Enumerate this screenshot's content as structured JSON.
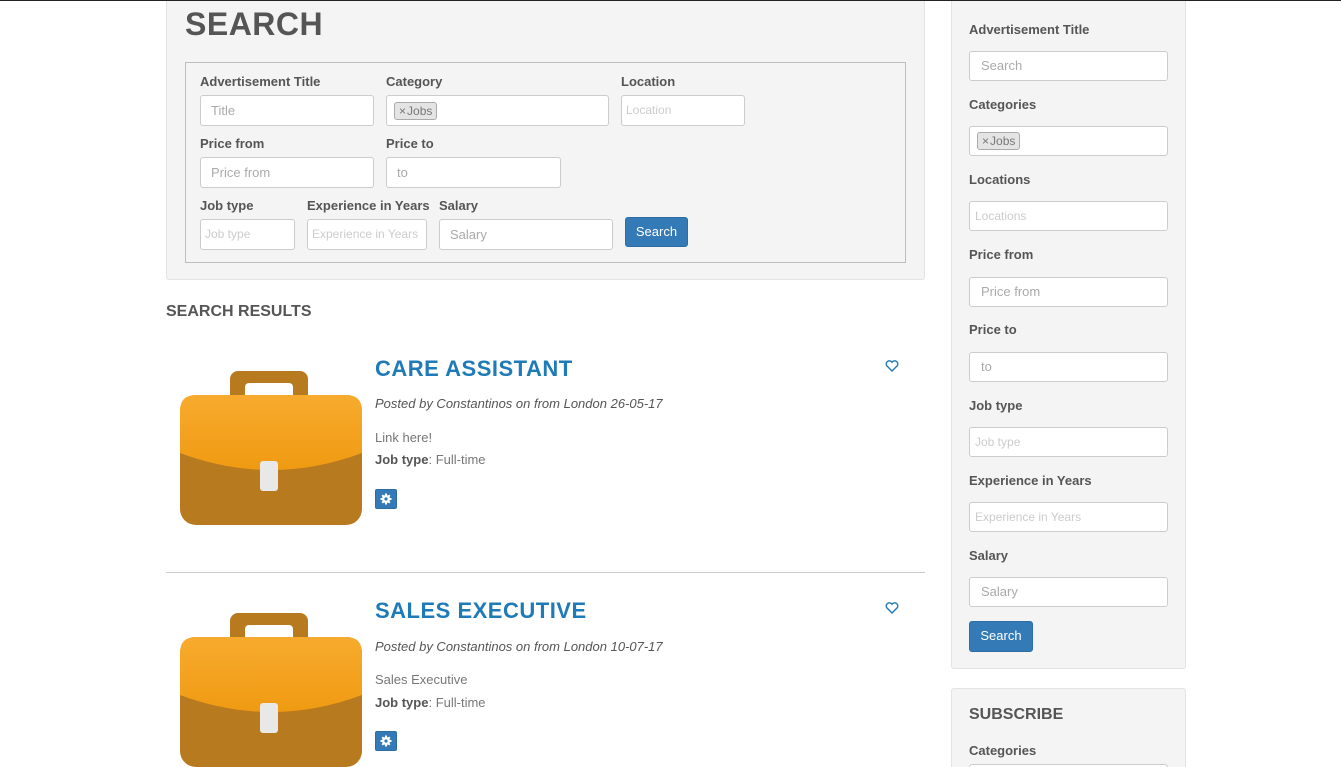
{
  "search": {
    "heading": "SEARCH",
    "fields": {
      "title": {
        "label": "Advertisement Title",
        "placeholder": "Title"
      },
      "category": {
        "label": "Category",
        "tag": "Jobs"
      },
      "location": {
        "label": "Location",
        "placeholder": "Location"
      },
      "price_from": {
        "label": "Price from",
        "placeholder": "Price from"
      },
      "price_to": {
        "label": "Price to",
        "placeholder": "to"
      },
      "job_type": {
        "label": "Job type",
        "placeholder": "Job type"
      },
      "experience": {
        "label": "Experience in Years",
        "placeholder": "Experience in Years"
      },
      "salary": {
        "label": "Salary",
        "placeholder": "Salary"
      }
    },
    "button": "Search"
  },
  "results": {
    "heading": "SEARCH RESULTS",
    "items": [
      {
        "title": "CARE ASSISTANT",
        "meta": "Posted by Constantinos on from London 26-05-17",
        "description": "Link here!",
        "job_type_label": "Job type",
        "job_type_value": ": Full-time",
        "icon": "briefcase-icon"
      },
      {
        "title": "SALES EXECUTIVE",
        "meta": "Posted by Constantinos on from London 10-07-17",
        "description": "Sales Executive",
        "job_type_label": "Job type",
        "job_type_value": ": Full-time",
        "icon": "briefcase-icon"
      }
    ]
  },
  "sidebar": {
    "fields": [
      {
        "label": "Advertisement Title",
        "placeholder": "Search"
      },
      {
        "label": "Categories",
        "tag": "Jobs"
      },
      {
        "label": "Locations",
        "placeholder": "Locations"
      },
      {
        "label": "Price from",
        "placeholder": "Price from"
      },
      {
        "label": "Price to",
        "placeholder": "to"
      },
      {
        "label": "Job type",
        "placeholder": "Job type"
      },
      {
        "label": "Experience in Years",
        "placeholder": "Experience in Years"
      },
      {
        "label": "Salary",
        "placeholder": "Salary"
      }
    ],
    "button": "Search"
  },
  "subscribe": {
    "heading": "SUBSCRIBE",
    "categories_label": "Categories"
  },
  "colors": {
    "accent": "#337ab7",
    "title_link": "#1f7ab8",
    "briefcase_top": "#f5a623",
    "briefcase_bottom": "#b87a1f"
  }
}
